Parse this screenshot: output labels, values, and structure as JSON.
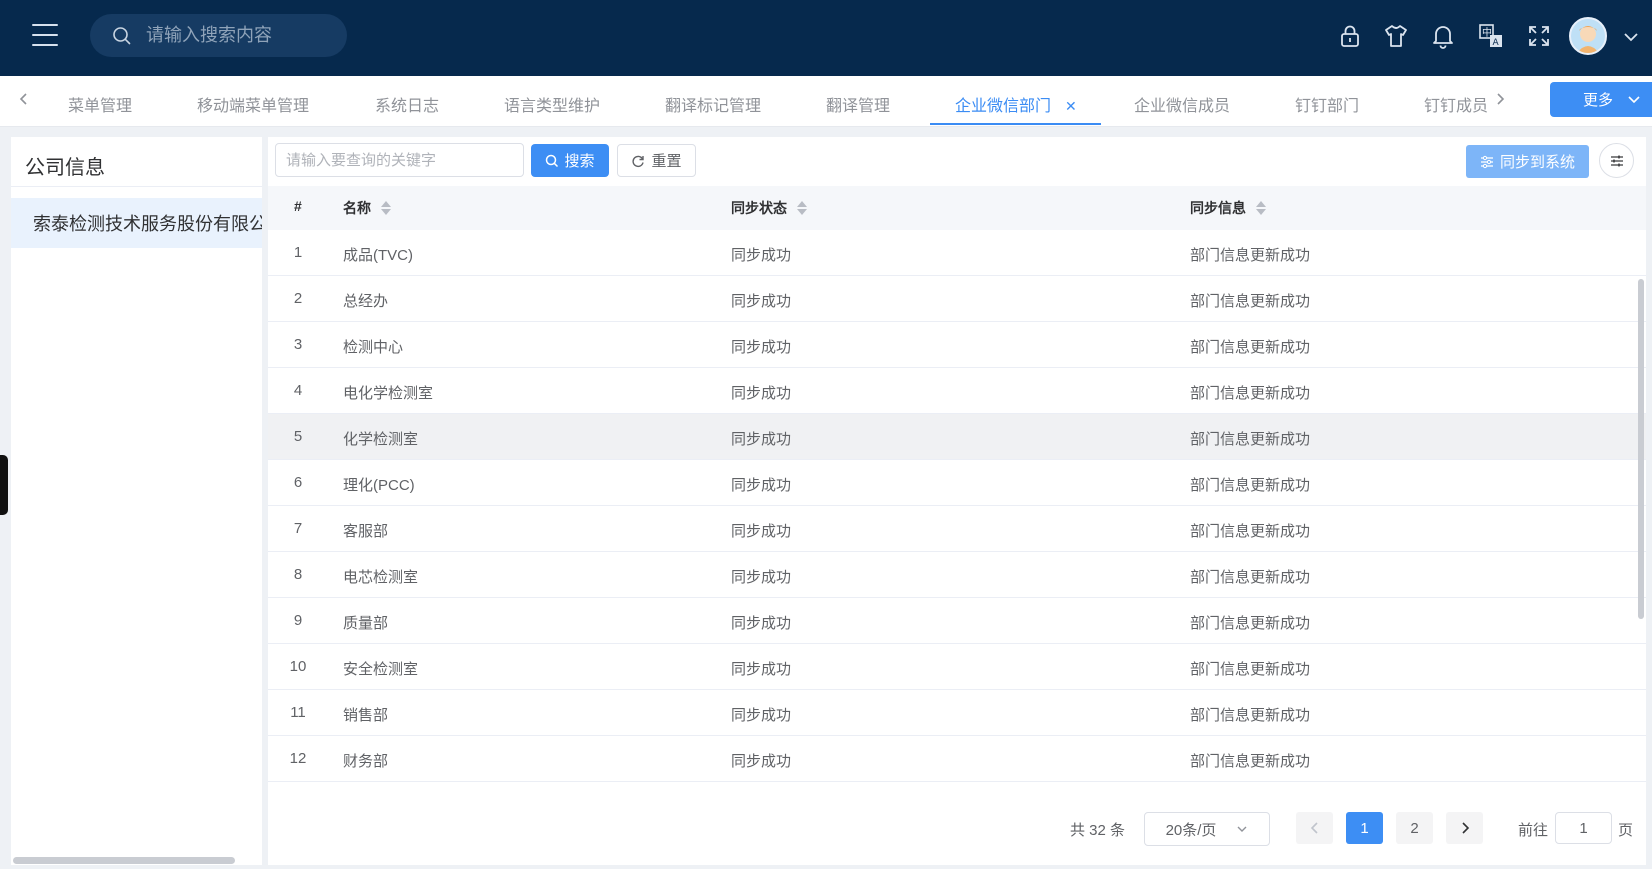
{
  "header": {
    "search_placeholder": "请输入搜索内容",
    "icons": [
      "menu-icon",
      "lock-icon",
      "shirt-icon",
      "bell-icon",
      "translate-icon",
      "fullscreen-icon",
      "avatar",
      "chevron-down-icon"
    ]
  },
  "tabs": {
    "items": [
      {
        "label": "菜单管理"
      },
      {
        "label": "移动端菜单管理"
      },
      {
        "label": "系统日志"
      },
      {
        "label": "语言类型维护"
      },
      {
        "label": "翻译标记管理"
      },
      {
        "label": "翻译管理"
      },
      {
        "label": "企业微信部门",
        "active": true
      },
      {
        "label": "企业微信成员"
      },
      {
        "label": "钉钉部门"
      },
      {
        "label": "钉钉成员"
      }
    ],
    "more_label": "更多"
  },
  "left_panel": {
    "title": "公司信息",
    "tree_item": "索泰检测技术服务股份有限公司"
  },
  "toolbar": {
    "keyword_placeholder": "请输入要查询的关键字",
    "search_label": "搜索",
    "reset_label": "重置",
    "sync_label": "同步到系统"
  },
  "table": {
    "headers": {
      "index": "#",
      "name": "名称",
      "status": "同步状态",
      "info": "同步信息"
    },
    "rows": [
      {
        "index": "1",
        "name": "成品(TVC)",
        "status": "同步成功",
        "info": "部门信息更新成功"
      },
      {
        "index": "2",
        "name": "总经办",
        "status": "同步成功",
        "info": "部门信息更新成功"
      },
      {
        "index": "3",
        "name": "检测中心",
        "status": "同步成功",
        "info": "部门信息更新成功"
      },
      {
        "index": "4",
        "name": "电化学检测室",
        "status": "同步成功",
        "info": "部门信息更新成功"
      },
      {
        "index": "5",
        "name": "化学检测室",
        "status": "同步成功",
        "info": "部门信息更新成功"
      },
      {
        "index": "6",
        "name": "理化(PCC)",
        "status": "同步成功",
        "info": "部门信息更新成功"
      },
      {
        "index": "7",
        "name": "客服部",
        "status": "同步成功",
        "info": "部门信息更新成功"
      },
      {
        "index": "8",
        "name": "电芯检测室",
        "status": "同步成功",
        "info": "部门信息更新成功"
      },
      {
        "index": "9",
        "name": "质量部",
        "status": "同步成功",
        "info": "部门信息更新成功"
      },
      {
        "index": "10",
        "name": "安全检测室",
        "status": "同步成功",
        "info": "部门信息更新成功"
      },
      {
        "index": "11",
        "name": "销售部",
        "status": "同步成功",
        "info": "部门信息更新成功"
      },
      {
        "index": "12",
        "name": "财务部",
        "status": "同步成功",
        "info": "部门信息更新成功"
      }
    ]
  },
  "pagination": {
    "total_text": "共 32 条",
    "page_size": "20条/页",
    "pages": [
      "1",
      "2"
    ],
    "current_page": "1",
    "goto_label": "前往",
    "goto_value": "1",
    "page_suffix": "页"
  },
  "colors": {
    "header_bg": "#06294d",
    "accent": "#3d8ef4",
    "sync_button": "#7db5f8"
  }
}
